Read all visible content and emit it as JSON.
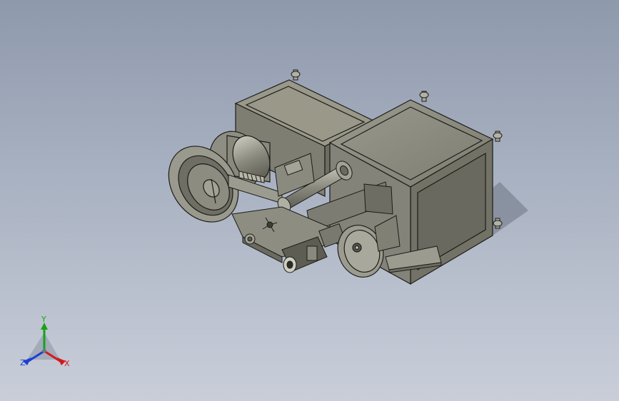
{
  "viewport": {
    "background_top": "#8e99ac",
    "background_bottom": "#c9ced9",
    "part_color": "#8d8c80",
    "edge_color": "#1c1c18"
  },
  "triad": {
    "x_label": "X",
    "y_label": "Y",
    "z_label": "Z",
    "x_color": "#d21a1a",
    "y_color": "#17a317",
    "z_color": "#1a3fd2"
  }
}
